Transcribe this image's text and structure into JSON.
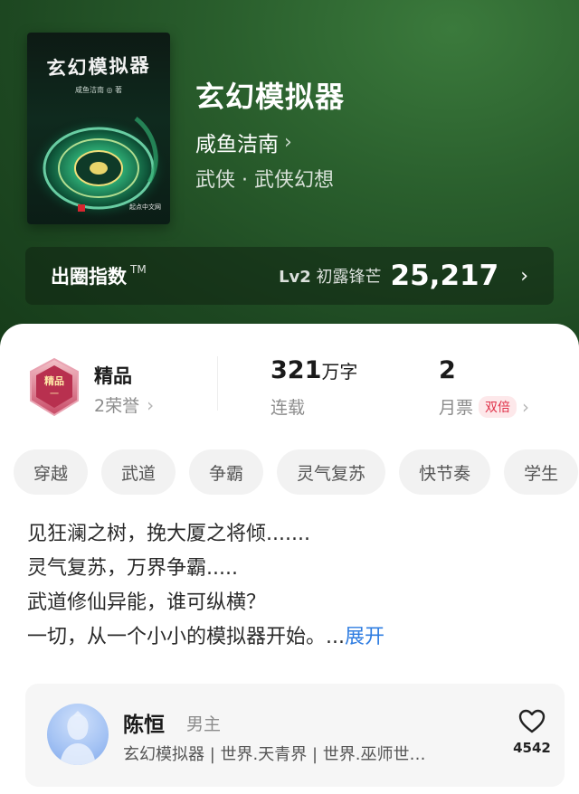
{
  "book": {
    "cover_title": "玄幻模拟器",
    "cover_author": "咸鱼洁南 ◎ 著",
    "cover_publisher": "起点中文网",
    "title": "玄幻模拟器",
    "author": "咸鱼洁南",
    "author_chevron": "›",
    "genre": "武侠 · 武侠幻想"
  },
  "index_bar": {
    "label": "出圈指数",
    "tm": "TM",
    "level_prefix": "Lv2",
    "level_name": "初露锋芒",
    "score": "25,217",
    "chevron": "›"
  },
  "stats": {
    "quality": "精品",
    "honors": "2荣誉",
    "word_count": "321",
    "word_unit": "万字",
    "status": "连载",
    "monthly_tickets": "2",
    "tickets_label": "月票",
    "double_badge": "双倍",
    "chevron": "›"
  },
  "tags": [
    "穿越",
    "武道",
    "争霸",
    "灵气复苏",
    "快节奏",
    "学生"
  ],
  "description": {
    "lines": [
      "见狂澜之树，挽大厦之将倾.......",
      "灵气复苏，万界争霸.....",
      "武道修仙异能，谁可纵横？",
      "一切，从一个小小的模拟器开始。..."
    ],
    "expand": "展开"
  },
  "character": {
    "name": "陈恒",
    "role": "男主",
    "info": "玄幻模拟器 | 世界.天青界 | 世界.巫师世…",
    "likes": "4542",
    "like_icon": "heart-outline-icon"
  },
  "colors": {
    "hero_bg": "#2a5f2d",
    "accent_link": "#2f7de1",
    "double_badge_text": "#e0324a",
    "double_badge_bg": "#fde8ea"
  }
}
